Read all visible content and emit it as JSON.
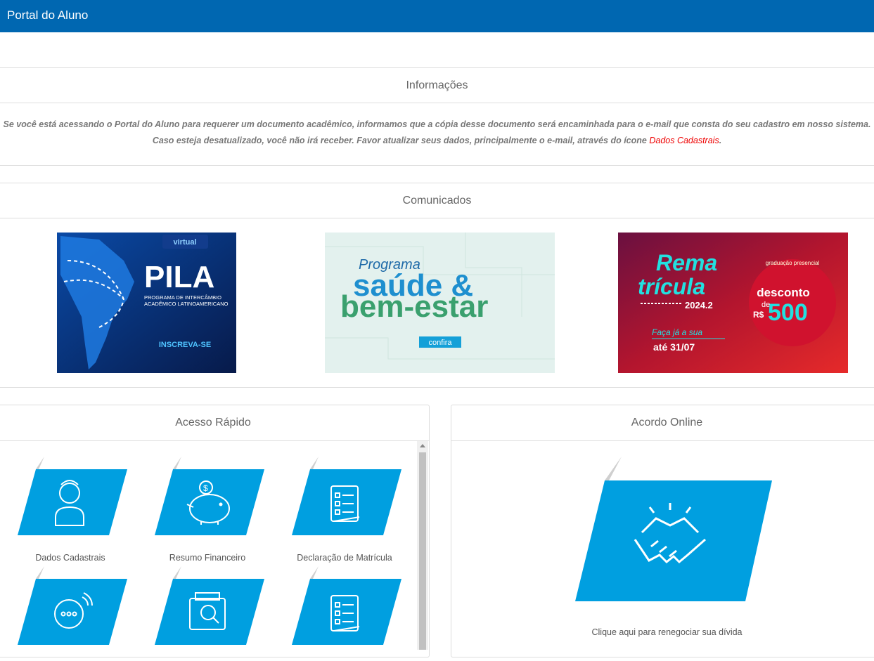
{
  "header": {
    "title": "Portal do Aluno"
  },
  "info": {
    "heading": "Informações",
    "line1": "Se você está acessando o Portal do Aluno para requerer um documento acadêmico, informamos que a cópia desse documento será encaminhada para o e-mail que consta do seu cadastro em nosso sistema.",
    "line2_pre": "Caso esteja desatualizado, você não irá receber. Favor atualizar seus dados, principalmente o e-mail, através do ícone ",
    "line2_link": "Dados Cadastrais",
    "line2_post": "."
  },
  "comunicados": {
    "heading": "Comunicados",
    "banners": [
      {
        "tag": "virtual",
        "title": "PILA",
        "sub1": "PROGRAMA DE INTERCÂMBIO",
        "sub2": "ACADÊMICO LATINOAMERICANO",
        "cta": "INSCREVA-SE"
      },
      {
        "line1": "Programa",
        "line2": "saúde &",
        "line3": "bem-estar",
        "cta": "confira"
      },
      {
        "line1": "Rema",
        "line2": "trícula",
        "year": "2024.2",
        "tag": "graduação presencial",
        "discount": "desconto",
        "de": "de",
        "currency": "R$",
        "value": "500",
        "call": "Faça já a sua",
        "date": "até 31/07"
      }
    ]
  },
  "acesso": {
    "heading": "Acesso Rápido",
    "tiles": [
      {
        "label": "Dados Cadastrais",
        "icon": "person-icon"
      },
      {
        "label": "Resumo Financeiro",
        "icon": "piggy-bank-icon"
      },
      {
        "label": "Declaração de Matrícula",
        "icon": "document-checklist-icon"
      },
      {
        "label": "",
        "icon": "chat-icon"
      },
      {
        "label": "",
        "icon": "document-search-icon"
      },
      {
        "label": "",
        "icon": "document-checklist-icon"
      }
    ]
  },
  "acordo": {
    "heading": "Acordo Online",
    "label": "Clique aqui para renegociar sua dívida",
    "icon": "handshake-icon"
  },
  "colors": {
    "header": "#0067b1",
    "tile": "#009fe0",
    "link": "#e00000"
  }
}
